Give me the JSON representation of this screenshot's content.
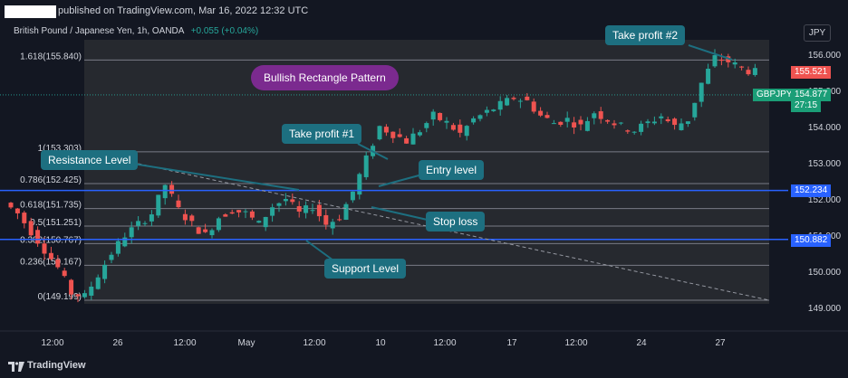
{
  "header": {
    "published_text": "published on TradingView.com, Mar 16, 2022 12:32 UTC",
    "instrument": "British Pound / Japanese Yen, 1h, OANDA",
    "change": "+0.055 (+0.04%)",
    "currency": "JPY"
  },
  "footer": {
    "brand": "TradingView"
  },
  "annotations": {
    "take_profit_2": "Take profit #2",
    "pattern": "Bullish Rectangle Pattern",
    "take_profit_1": "Take profit #1",
    "resistance": "Resistance Level",
    "entry": "Entry level",
    "stop_loss": "Stop loss",
    "support": "Support Level"
  },
  "price_badges": {
    "last_price": "155.521",
    "symbol": "GBPJPY",
    "symbol_price": "154.877",
    "countdown": "27:15",
    "resistance_price": "152.234",
    "support_price": "150.882"
  },
  "colors": {
    "background": "#131722",
    "highlight_band": "#26292f",
    "up_candle": "#26a69a",
    "down_candle": "#ef5350",
    "level_line": "#2962ff",
    "annotation_teal": "#1d6f80",
    "annotation_purple": "#7b2a8f"
  },
  "chart_data": {
    "type": "candlestick",
    "ylim": [
      148.8,
      156.5
    ],
    "price_axis_ticks": [
      156.0,
      155.0,
      154.0,
      153.0,
      152.0,
      151.0,
      150.0,
      149.0
    ],
    "price_axis_labels": [
      "156.000",
      "155.000",
      "154.000",
      "153.000",
      "152.000",
      "151.000",
      "150.000",
      "149.000"
    ],
    "time_axis_labels": [
      "12:00",
      "26",
      "12:00",
      "May",
      "12:00",
      "10",
      "12:00",
      "17",
      "12:00",
      "24",
      "27"
    ],
    "fibonacci": [
      {
        "label": "1.618(155.840)",
        "price": 155.84
      },
      {
        "label": "1(153.303)",
        "price": 153.303
      },
      {
        "label": "0.786(152.425)",
        "price": 152.425
      },
      {
        "label": "0.618(151.735)",
        "price": 151.735
      },
      {
        "label": "0.5(151.251)",
        "price": 151.251
      },
      {
        "label": "0.382(150.767)",
        "price": 150.767
      },
      {
        "label": "0.236(150.167)",
        "price": 150.167
      },
      {
        "label": "0(149.199)",
        "price": 149.199
      }
    ],
    "resistance_level": 152.234,
    "support_level": 150.882,
    "last_price": 155.521,
    "symbol_price": 154.877,
    "price_path": [
      [
        0,
        151.9
      ],
      [
        2,
        151.6
      ],
      [
        4,
        151.1
      ],
      [
        6,
        150.6
      ],
      [
        8,
        150.1
      ],
      [
        10,
        149.4
      ],
      [
        12,
        149.3
      ],
      [
        14,
        149.9
      ],
      [
        16,
        150.5
      ],
      [
        18,
        151.0
      ],
      [
        20,
        151.3
      ],
      [
        22,
        151.6
      ],
      [
        24,
        152.4
      ],
      [
        26,
        151.7
      ],
      [
        28,
        151.3
      ],
      [
        30,
        151.0
      ],
      [
        32,
        151.5
      ],
      [
        34,
        151.7
      ],
      [
        36,
        151.6
      ],
      [
        38,
        151.3
      ],
      [
        40,
        151.8
      ],
      [
        42,
        152.0
      ],
      [
        44,
        151.6
      ],
      [
        46,
        151.8
      ],
      [
        48,
        151.3
      ],
      [
        50,
        151.5
      ],
      [
        52,
        152.2
      ],
      [
        54,
        153.1
      ],
      [
        56,
        154.0
      ],
      [
        58,
        153.8
      ],
      [
        60,
        153.6
      ],
      [
        62,
        153.9
      ],
      [
        64,
        154.3
      ],
      [
        66,
        154.1
      ],
      [
        68,
        153.8
      ],
      [
        70,
        154.2
      ],
      [
        72,
        154.4
      ],
      [
        74,
        154.6
      ],
      [
        76,
        154.8
      ],
      [
        78,
        154.7
      ],
      [
        80,
        154.3
      ],
      [
        82,
        154.1
      ],
      [
        84,
        154.2
      ],
      [
        86,
        154.0
      ],
      [
        88,
        154.4
      ],
      [
        90,
        154.2
      ],
      [
        92,
        154.0
      ],
      [
        94,
        153.9
      ],
      [
        96,
        154.1
      ],
      [
        98,
        154.3
      ],
      [
        100,
        154.0
      ],
      [
        102,
        154.2
      ],
      [
        104,
        155.2
      ],
      [
        106,
        155.9
      ],
      [
        108,
        155.8
      ],
      [
        110,
        155.6
      ],
      [
        112,
        155.5
      ]
    ]
  }
}
